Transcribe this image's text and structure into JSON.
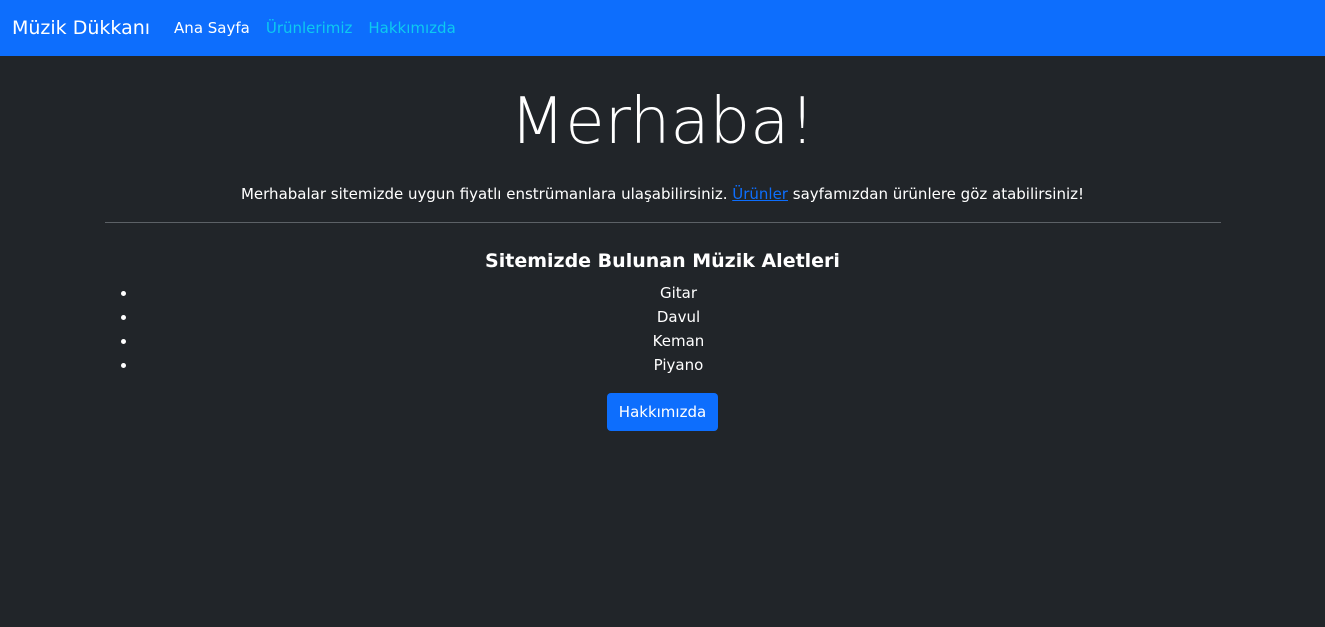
{
  "navbar": {
    "brand": "Müzik Dükkanı",
    "links": [
      {
        "label": "Ana Sayfa"
      },
      {
        "label": "Ürünlerimiz"
      },
      {
        "label": "Hakkımızda"
      }
    ]
  },
  "hero": {
    "title": "Merhaba!",
    "text_before": "Merhabalar sitemizde uygun fiyatlı enstrümanlara ulaşabilirsiniz. ",
    "link_label": "Ürünler",
    "text_after": " sayfamızdan ürünlere göz atabilirsiniz!"
  },
  "instruments": {
    "title": "Sitemizde Bulunan Müzik Aletleri",
    "items": [
      "Gitar",
      "Davul",
      "Keman",
      "Piyano"
    ]
  },
  "about_button": {
    "label": "Hakkımızda"
  },
  "colors": {
    "navbar_bg": "#0d6efd",
    "page_bg": "#212529",
    "info_link": "#0dcaf0"
  }
}
